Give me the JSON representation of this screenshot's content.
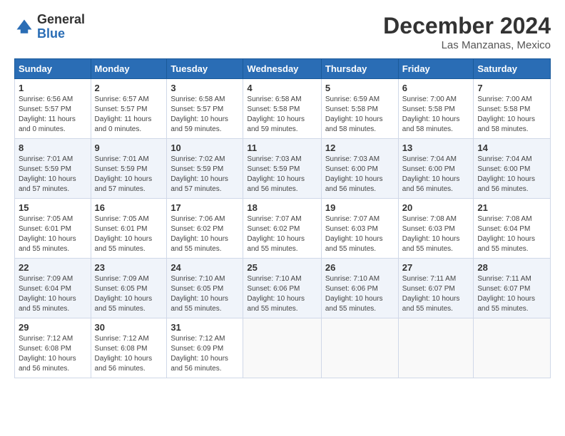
{
  "header": {
    "logo_general": "General",
    "logo_blue": "Blue",
    "title": "December 2024",
    "subtitle": "Las Manzanas, Mexico"
  },
  "days_of_week": [
    "Sunday",
    "Monday",
    "Tuesday",
    "Wednesday",
    "Thursday",
    "Friday",
    "Saturday"
  ],
  "weeks": [
    [
      {
        "num": "1",
        "info": "Sunrise: 6:56 AM\nSunset: 5:57 PM\nDaylight: 11 hours\nand 0 minutes."
      },
      {
        "num": "2",
        "info": "Sunrise: 6:57 AM\nSunset: 5:57 PM\nDaylight: 11 hours\nand 0 minutes."
      },
      {
        "num": "3",
        "info": "Sunrise: 6:58 AM\nSunset: 5:57 PM\nDaylight: 10 hours\nand 59 minutes."
      },
      {
        "num": "4",
        "info": "Sunrise: 6:58 AM\nSunset: 5:58 PM\nDaylight: 10 hours\nand 59 minutes."
      },
      {
        "num": "5",
        "info": "Sunrise: 6:59 AM\nSunset: 5:58 PM\nDaylight: 10 hours\nand 58 minutes."
      },
      {
        "num": "6",
        "info": "Sunrise: 7:00 AM\nSunset: 5:58 PM\nDaylight: 10 hours\nand 58 minutes."
      },
      {
        "num": "7",
        "info": "Sunrise: 7:00 AM\nSunset: 5:58 PM\nDaylight: 10 hours\nand 58 minutes."
      }
    ],
    [
      {
        "num": "8",
        "info": "Sunrise: 7:01 AM\nSunset: 5:59 PM\nDaylight: 10 hours\nand 57 minutes."
      },
      {
        "num": "9",
        "info": "Sunrise: 7:01 AM\nSunset: 5:59 PM\nDaylight: 10 hours\nand 57 minutes."
      },
      {
        "num": "10",
        "info": "Sunrise: 7:02 AM\nSunset: 5:59 PM\nDaylight: 10 hours\nand 57 minutes."
      },
      {
        "num": "11",
        "info": "Sunrise: 7:03 AM\nSunset: 5:59 PM\nDaylight: 10 hours\nand 56 minutes."
      },
      {
        "num": "12",
        "info": "Sunrise: 7:03 AM\nSunset: 6:00 PM\nDaylight: 10 hours\nand 56 minutes."
      },
      {
        "num": "13",
        "info": "Sunrise: 7:04 AM\nSunset: 6:00 PM\nDaylight: 10 hours\nand 56 minutes."
      },
      {
        "num": "14",
        "info": "Sunrise: 7:04 AM\nSunset: 6:00 PM\nDaylight: 10 hours\nand 56 minutes."
      }
    ],
    [
      {
        "num": "15",
        "info": "Sunrise: 7:05 AM\nSunset: 6:01 PM\nDaylight: 10 hours\nand 55 minutes."
      },
      {
        "num": "16",
        "info": "Sunrise: 7:05 AM\nSunset: 6:01 PM\nDaylight: 10 hours\nand 55 minutes."
      },
      {
        "num": "17",
        "info": "Sunrise: 7:06 AM\nSunset: 6:02 PM\nDaylight: 10 hours\nand 55 minutes."
      },
      {
        "num": "18",
        "info": "Sunrise: 7:07 AM\nSunset: 6:02 PM\nDaylight: 10 hours\nand 55 minutes."
      },
      {
        "num": "19",
        "info": "Sunrise: 7:07 AM\nSunset: 6:03 PM\nDaylight: 10 hours\nand 55 minutes."
      },
      {
        "num": "20",
        "info": "Sunrise: 7:08 AM\nSunset: 6:03 PM\nDaylight: 10 hours\nand 55 minutes."
      },
      {
        "num": "21",
        "info": "Sunrise: 7:08 AM\nSunset: 6:04 PM\nDaylight: 10 hours\nand 55 minutes."
      }
    ],
    [
      {
        "num": "22",
        "info": "Sunrise: 7:09 AM\nSunset: 6:04 PM\nDaylight: 10 hours\nand 55 minutes."
      },
      {
        "num": "23",
        "info": "Sunrise: 7:09 AM\nSunset: 6:05 PM\nDaylight: 10 hours\nand 55 minutes."
      },
      {
        "num": "24",
        "info": "Sunrise: 7:10 AM\nSunset: 6:05 PM\nDaylight: 10 hours\nand 55 minutes."
      },
      {
        "num": "25",
        "info": "Sunrise: 7:10 AM\nSunset: 6:06 PM\nDaylight: 10 hours\nand 55 minutes."
      },
      {
        "num": "26",
        "info": "Sunrise: 7:10 AM\nSunset: 6:06 PM\nDaylight: 10 hours\nand 55 minutes."
      },
      {
        "num": "27",
        "info": "Sunrise: 7:11 AM\nSunset: 6:07 PM\nDaylight: 10 hours\nand 55 minutes."
      },
      {
        "num": "28",
        "info": "Sunrise: 7:11 AM\nSunset: 6:07 PM\nDaylight: 10 hours\nand 55 minutes."
      }
    ],
    [
      {
        "num": "29",
        "info": "Sunrise: 7:12 AM\nSunset: 6:08 PM\nDaylight: 10 hours\nand 56 minutes."
      },
      {
        "num": "30",
        "info": "Sunrise: 7:12 AM\nSunset: 6:08 PM\nDaylight: 10 hours\nand 56 minutes."
      },
      {
        "num": "31",
        "info": "Sunrise: 7:12 AM\nSunset: 6:09 PM\nDaylight: 10 hours\nand 56 minutes."
      },
      null,
      null,
      null,
      null
    ]
  ]
}
